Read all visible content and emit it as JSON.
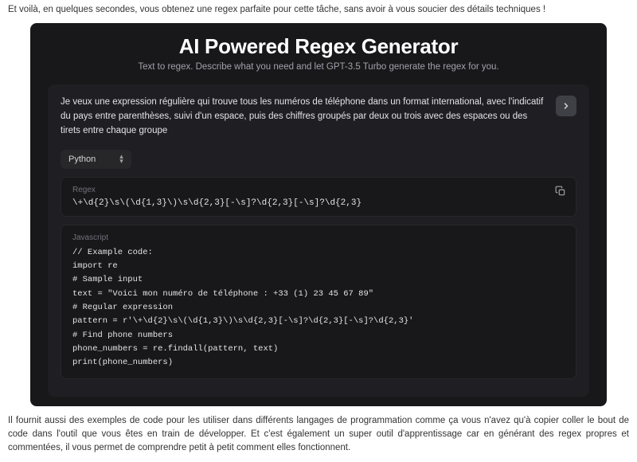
{
  "article": {
    "intro": "Et voilà, en quelques secondes, vous obtenez une regex parfaite pour cette tâche, sans avoir à vous soucier des détails techniques !",
    "outro": "Il fournit aussi des exemples de code pour les utiliser dans différents langages de programmation comme ça vous n'avez qu'à copier coller le bout de code dans l'outil que vous êtes en train de développer. Et c'est également un super outil d'apprentissage car en générant des regex propres et commentées, il vous permet de comprendre petit à petit comment elles fonctionnent."
  },
  "app": {
    "title": "AI Powered Regex Generator",
    "subtitle": "Text to regex. Describe what you need and let GPT-3.5 Turbo generate the regex for you.",
    "prompt": "Je veux une expression régulière qui trouve tous les numéros de téléphone dans un format international, avec l'indicatif du pays entre parenthèses, suivi d'un espace, puis des chiffres groupés par deux ou trois avec des espaces ou des tirets entre chaque groupe",
    "language": "Python",
    "regex_label": "Regex",
    "regex_value": "\\+\\d{2}\\s\\(\\d{1,3}\\)\\s\\d{2,3}[-\\s]?\\d{2,3}[-\\s]?\\d{2,3}",
    "code_label": "Javascript",
    "code": "// Example code:\nimport re\n# Sample input\ntext = \"Voici mon numéro de téléphone : +33 (1) 23 45 67 89\"\n# Regular expression\npattern = r'\\+\\d{2}\\s\\(\\d{1,3}\\)\\s\\d{2,3}[-\\s]?\\d{2,3}[-\\s]?\\d{2,3}'\n# Find phone numbers\nphone_numbers = re.findall(pattern, text)\nprint(phone_numbers)"
  }
}
